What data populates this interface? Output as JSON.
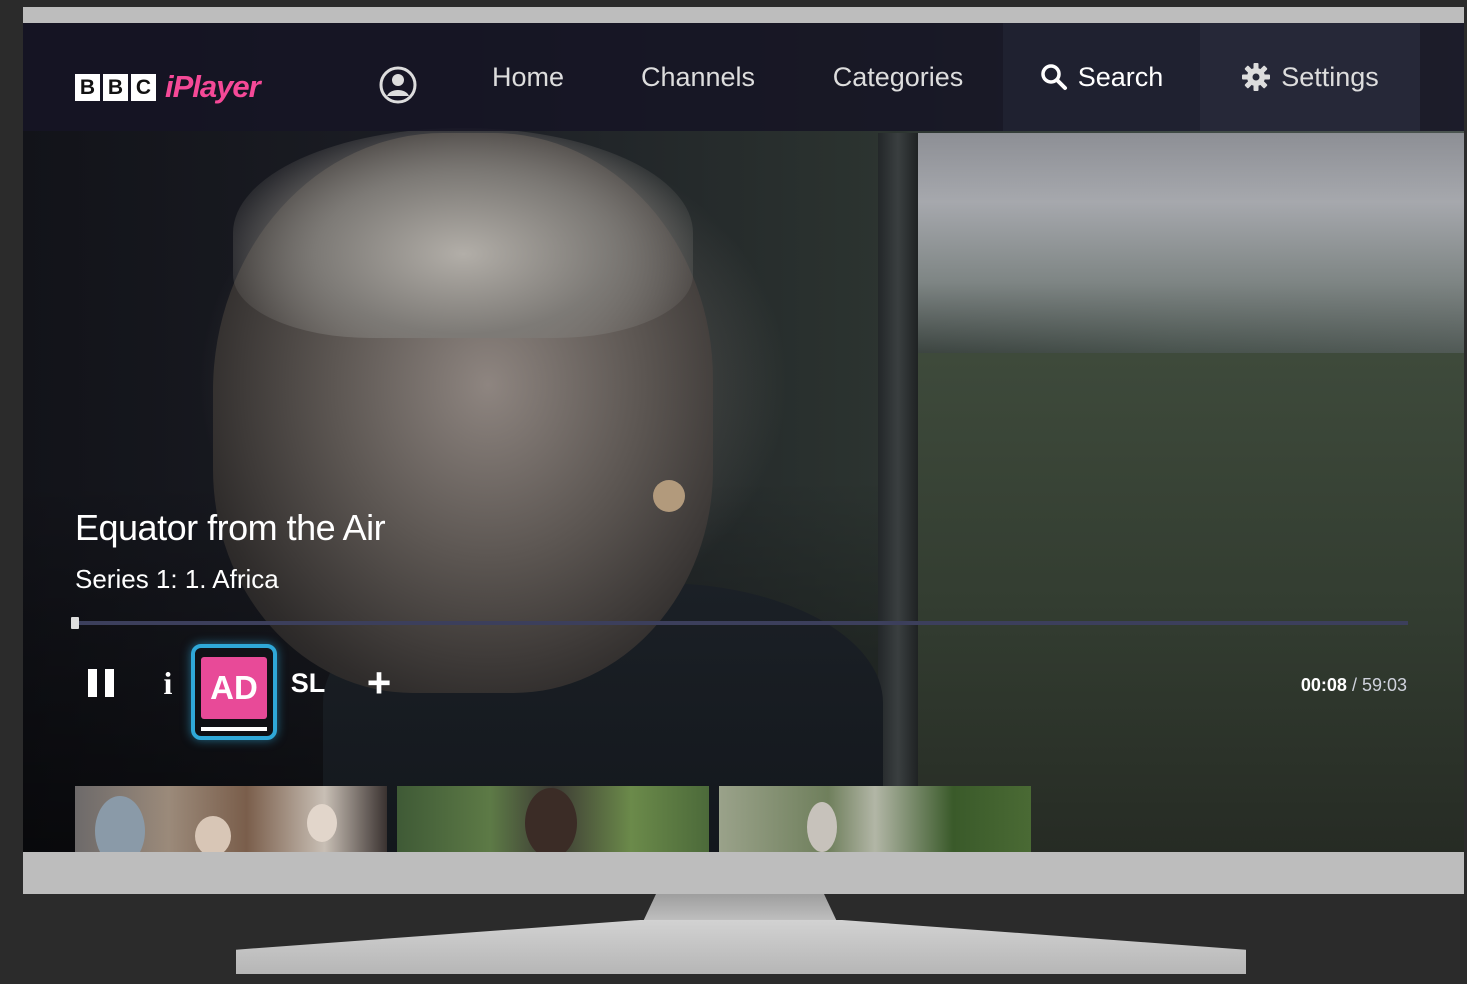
{
  "app": {
    "brand_bbc": [
      "B",
      "B",
      "C"
    ],
    "brand_iplayer": "iPlayer",
    "accent_color": "#f54997"
  },
  "nav": {
    "items": [
      {
        "label": "Home",
        "icon": ""
      },
      {
        "label": "Channels",
        "icon": ""
      },
      {
        "label": "Categories",
        "icon": ""
      },
      {
        "label": "Search",
        "icon": "search-icon"
      },
      {
        "label": "Settings",
        "icon": "gear-icon"
      }
    ],
    "account_icon": "account-icon"
  },
  "program": {
    "title": "Equator from the Air",
    "episode": "Series 1: 1. Africa"
  },
  "playback": {
    "current_time": "00:08",
    "separator": " / ",
    "duration": "59:03",
    "progress_fraction": 0.0023,
    "controls": {
      "pause_icon": "pause-icon",
      "info_label": "i",
      "ad_label": "AD",
      "sl_label": "SL",
      "add_label": "+"
    },
    "ad_highlight_color": "#2fa8d8",
    "ad_color": "#e84a98"
  },
  "thumbnails": [
    {
      "icon": "episode-thumbnail"
    },
    {
      "icon": "episode-thumbnail"
    },
    {
      "icon": "episode-thumbnail"
    }
  ]
}
